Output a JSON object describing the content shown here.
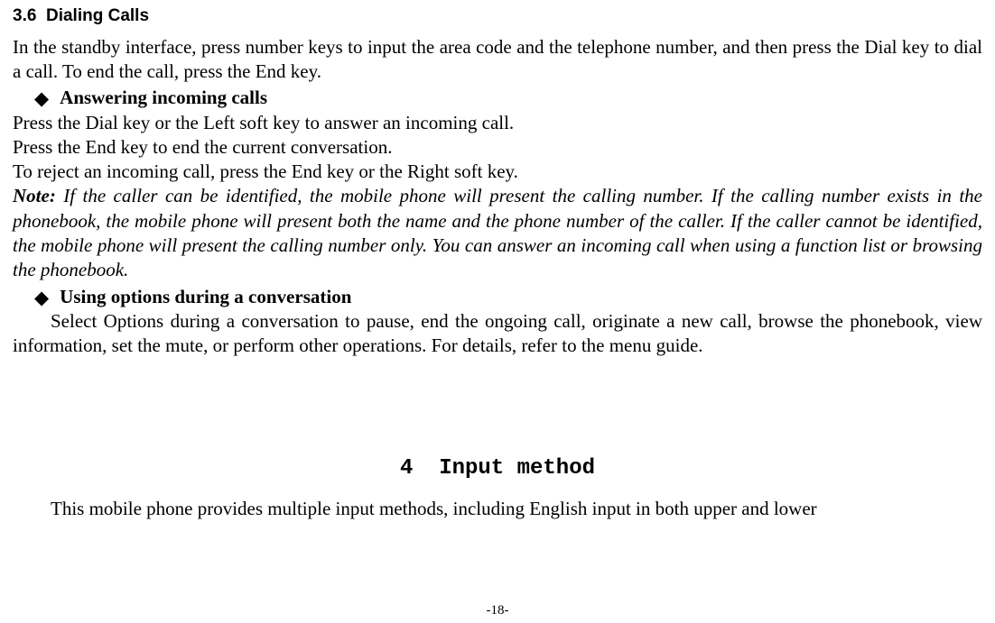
{
  "section": {
    "number": "3.6",
    "title": "Dialing Calls"
  },
  "intro": "In the standby interface, press number keys to input the area code and the telephone number, and then press the Dial key to dial a call. To end the call, press the End key.",
  "bullet1": {
    "title": "Answering incoming calls",
    "line1": "Press the Dial key or the Left soft key to answer an incoming call.",
    "line2": "Press the End key to end the current conversation.",
    "line3": "To reject an incoming call, press the End key or the Right soft key."
  },
  "note": {
    "label": "Note:",
    "text": " If the caller can be identified, the mobile phone will present the calling number. If the calling number exists in the phonebook, the mobile phone will present both the name and the phone number of the caller. If the caller cannot be identified, the mobile phone will present the calling number only. You can answer an incoming call when using a function list or browsing the phonebook."
  },
  "bullet2": {
    "title": "Using options during a conversation",
    "para": "Select Options during a conversation to pause, end the ongoing call, originate a new call, browse the phonebook, view information, set the mute, or perform other operations. For details, refer to the menu guide."
  },
  "chapter": {
    "number": "4",
    "title": "Input method"
  },
  "chapter_intro": "This mobile phone provides multiple input methods, including English input in both upper and lower",
  "page_number": "-18-"
}
